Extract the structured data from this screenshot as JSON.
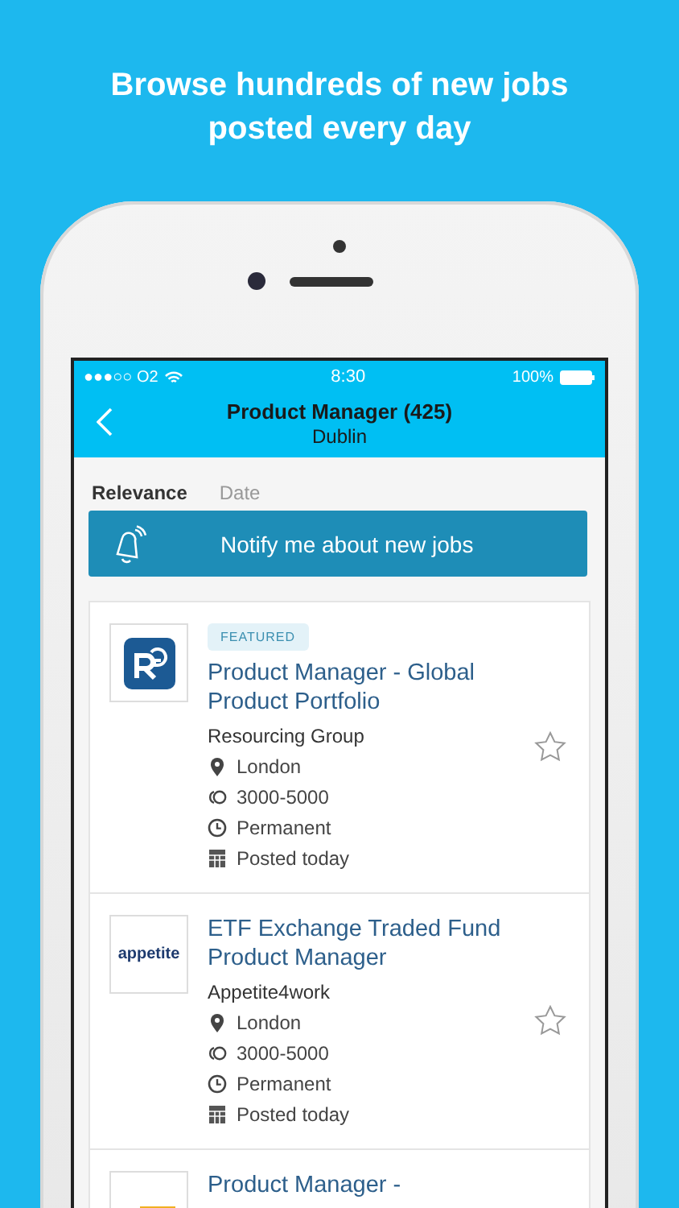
{
  "headline": "Browse hundreds of new jobs posted every day",
  "status_bar": {
    "carrier": "●●●○○ O2",
    "time": "8:30",
    "battery": "100%"
  },
  "nav": {
    "title": "Product Manager (425)",
    "subtitle": "Dublin"
  },
  "sort_tabs": [
    {
      "label": "Relevance",
      "selected": true
    },
    {
      "label": "Date",
      "selected": false
    }
  ],
  "notify_button": "Notify me about new jobs",
  "jobs": [
    {
      "kind": "monogram",
      "badge": "FEATURED",
      "title": "Product Manager - Global Product Portfolio",
      "company": "Resourcing Group",
      "location": "London",
      "salary": "3000-5000",
      "type": "Permanent",
      "posted": "Posted today",
      "saved": false
    },
    {
      "kind": "wordmark",
      "logo_text": "appetite",
      "title": "ETF Exchange Traded Fund Product Manager",
      "company": "Appetite4work",
      "location": "London",
      "salary": "3000-5000",
      "type": "Permanent",
      "posted": "Posted today",
      "saved": false
    },
    {
      "kind": "emblem",
      "title": "Product Manager -"
    }
  ]
}
